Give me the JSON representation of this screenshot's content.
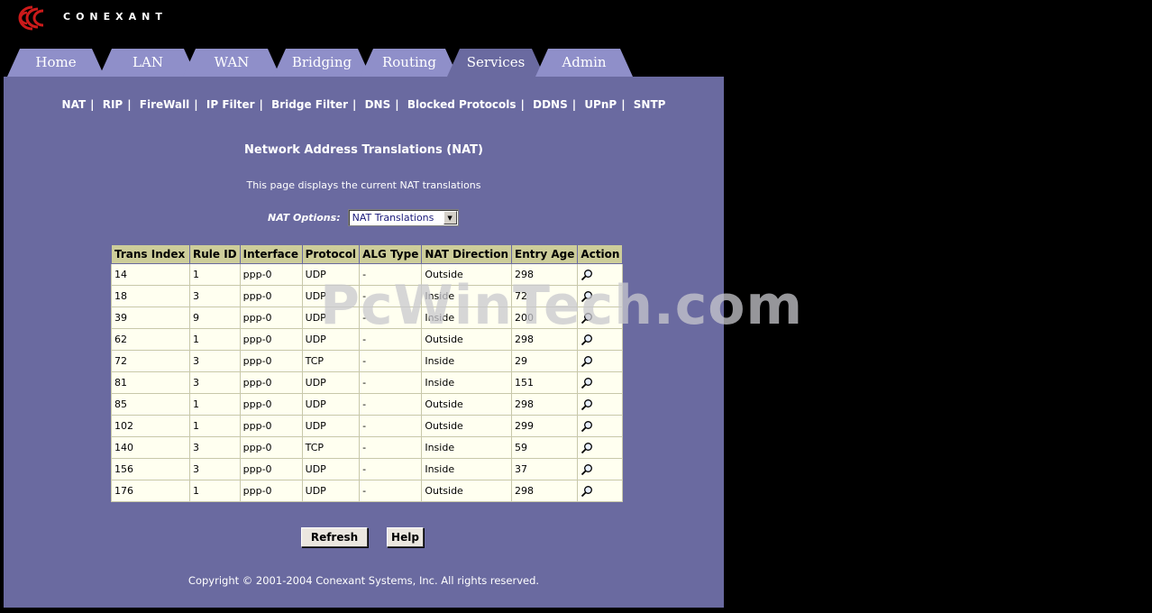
{
  "brand": {
    "name": "CONEXANT"
  },
  "tabs": [
    {
      "label": "Home",
      "active": false
    },
    {
      "label": "LAN",
      "active": false
    },
    {
      "label": "WAN",
      "active": false
    },
    {
      "label": "Bridging",
      "active": false
    },
    {
      "label": "Routing",
      "active": false
    },
    {
      "label": "Services",
      "active": true
    },
    {
      "label": "Admin",
      "active": false
    }
  ],
  "subnav": [
    "NAT",
    "RIP",
    "FireWall",
    "IP Filter",
    "Bridge Filter",
    "DNS",
    "Blocked Protocols",
    "DDNS",
    "UPnP",
    "SNTP"
  ],
  "page": {
    "title": "Network Address Translations (NAT)",
    "description": "This page displays the current NAT translations"
  },
  "options": {
    "label": "NAT Options:",
    "selected": "NAT Translations"
  },
  "table": {
    "headers": [
      "Trans Index",
      "Rule ID",
      "Interface",
      "Protocol",
      "ALG Type",
      "NAT Direction",
      "Entry Age",
      "Action"
    ],
    "rows": [
      [
        "14",
        "1",
        "ppp-0",
        "UDP",
        "-",
        "Outside",
        "298"
      ],
      [
        "18",
        "3",
        "ppp-0",
        "UDP",
        "-",
        "Inside",
        "72"
      ],
      [
        "39",
        "9",
        "ppp-0",
        "UDP",
        "-",
        "Inside",
        "200"
      ],
      [
        "62",
        "1",
        "ppp-0",
        "UDP",
        "-",
        "Outside",
        "298"
      ],
      [
        "72",
        "3",
        "ppp-0",
        "TCP",
        "-",
        "Inside",
        "29"
      ],
      [
        "81",
        "3",
        "ppp-0",
        "UDP",
        "-",
        "Inside",
        "151"
      ],
      [
        "85",
        "1",
        "ppp-0",
        "UDP",
        "-",
        "Outside",
        "298"
      ],
      [
        "102",
        "1",
        "ppp-0",
        "UDP",
        "-",
        "Outside",
        "299"
      ],
      [
        "140",
        "3",
        "ppp-0",
        "TCP",
        "-",
        "Inside",
        "59"
      ],
      [
        "156",
        "3",
        "ppp-0",
        "UDP",
        "-",
        "Inside",
        "37"
      ],
      [
        "176",
        "1",
        "ppp-0",
        "UDP",
        "-",
        "Outside",
        "298"
      ]
    ],
    "action_icon": "magnifier-icon"
  },
  "buttons": {
    "refresh": "Refresh",
    "help": "Help"
  },
  "footer": "Copyright © 2001-2004 Conexant Systems, Inc. All rights reserved.",
  "watermark": "PcWinTech.com",
  "colors": {
    "panel": "#6a6aa0",
    "tab": "#8f8fc9",
    "table_header": "#cdcd9a",
    "table_cell": "#fffff0",
    "logo_red": "#cc1a1a"
  }
}
